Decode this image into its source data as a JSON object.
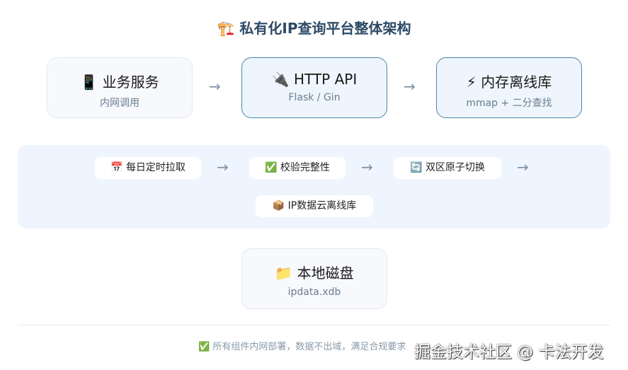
{
  "title": {
    "icon": "🏗️",
    "text": "私有化IP查询平台整体架构"
  },
  "top_row": [
    {
      "icon": "📱",
      "title": "业务服务",
      "subtitle": "内网调用"
    },
    {
      "icon": "🔌",
      "title": "HTTP API",
      "subtitle": "Flask / Gin"
    },
    {
      "icon": "⚡",
      "title": "内存离线库",
      "subtitle": "mmap + 二分查找"
    }
  ],
  "arrow": "→",
  "pipeline": [
    {
      "icon": "📅",
      "label": "每日定时拉取"
    },
    {
      "icon": "✅",
      "label": "校验完整性"
    },
    {
      "icon": "🔄",
      "label": "双区原子切换"
    },
    {
      "icon": "📦",
      "label": "IP数据云离线库"
    }
  ],
  "storage": {
    "icon": "📁",
    "title": "本地磁盘",
    "subtitle": "ipdata.xdb"
  },
  "footer": {
    "icon": "✅",
    "text": "所有组件内网部署，数据不出域，满足合规要求"
  },
  "watermark": "掘金技术社区 @ 卡法开发"
}
